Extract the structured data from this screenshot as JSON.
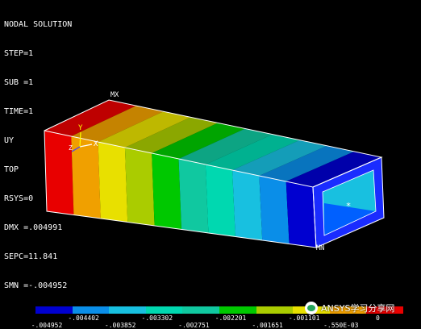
{
  "header": {
    "title": "NODAL SOLUTION",
    "lines": [
      "STEP=1",
      "SUB =1",
      "TIME=1",
      "UY",
      "TOP",
      "RSYS=0",
      "DMX =.004991",
      "SEPC=11.841",
      "SMN =-.004952"
    ]
  },
  "viewport": {
    "labels": {
      "max": "MX",
      "min": "MN"
    },
    "triad": {
      "x": "X",
      "y": "Y",
      "z": "Z"
    },
    "node_marker": "*"
  },
  "legend": {
    "colors": [
      "#0000d0",
      "#0a8ee8",
      "#18c0e0",
      "#00d8b0",
      "#10c8a0",
      "#00c800",
      "#aacc00",
      "#e8e000",
      "#f0a000",
      "#e80000"
    ],
    "upper_ticks": [
      "-.004402",
      "-.003302",
      "-.002201",
      "-.001101",
      "0"
    ],
    "lower_ticks": [
      "-.004952",
      "-.003852",
      "-.002751",
      "-.001651",
      "-.550E-03"
    ]
  },
  "watermark": {
    "text": "ANSYS学习分享网"
  },
  "chart_data": {
    "type": "heatmap",
    "quantity": "UY",
    "min": -0.004952,
    "max": 0,
    "dmx": 0.004991,
    "sepc": 11.841,
    "legend_values": [
      -0.004952,
      -0.004402,
      -0.003852,
      -0.003302,
      -0.002751,
      -0.002201,
      -0.001651,
      -0.001101,
      -0.00055,
      0
    ],
    "colors": [
      "#0000d0",
      "#0a8ee8",
      "#18c0e0",
      "#00d8b0",
      "#10c8a0",
      "#00c800",
      "#aacc00",
      "#e8e000",
      "#f0a000",
      "#e80000"
    ]
  }
}
